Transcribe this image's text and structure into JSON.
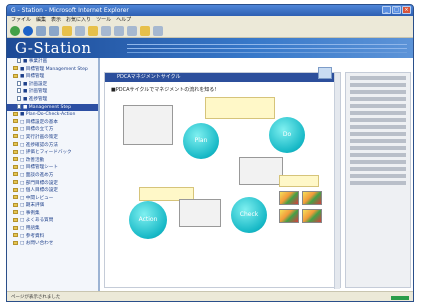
{
  "window": {
    "title": "G - Station - Microsoft Internet Explorer"
  },
  "menu": [
    "ファイル",
    "編集",
    "表示",
    "お気に入り",
    "ツール",
    "ヘルプ"
  ],
  "banner": {
    "logo": "G-Station"
  },
  "sidebar": {
    "items": [
      {
        "label": "■ 事業計画",
        "type": "doc"
      },
      {
        "label": "■ 目標管理 Management Step",
        "type": "fold"
      },
      {
        "label": "■ 目標管理",
        "type": "fold"
      },
      {
        "label": "■ 計画設定",
        "type": "doc"
      },
      {
        "label": "■ 計画管理",
        "type": "doc"
      },
      {
        "label": "■ 進捗管理",
        "type": "doc"
      },
      {
        "label": "■ Management Step",
        "type": "doc",
        "selected": true
      },
      {
        "label": "■ Plan-Do-Check-Action",
        "type": "fold"
      },
      {
        "label": "□ 目標設定の基本",
        "type": "fold"
      },
      {
        "label": "□ 目標の立て方",
        "type": "fold"
      },
      {
        "label": "□ 実行計画の策定",
        "type": "fold"
      },
      {
        "label": "□ 進捗確認の方法",
        "type": "fold"
      },
      {
        "label": "□ 評価とフィードバック",
        "type": "fold"
      },
      {
        "label": "□ 改善活動",
        "type": "fold"
      },
      {
        "label": "□ 目標管理シート",
        "type": "fold"
      },
      {
        "label": "□ 面談の進め方",
        "type": "fold"
      },
      {
        "label": "□ 部門目標の設定",
        "type": "fold"
      },
      {
        "label": "□ 個人目標の設定",
        "type": "fold"
      },
      {
        "label": "□ 中間レビュー",
        "type": "fold"
      },
      {
        "label": "□ 期末評価",
        "type": "fold"
      },
      {
        "label": "□ 事例集",
        "type": "fold"
      },
      {
        "label": "□ よくある質問",
        "type": "fold"
      },
      {
        "label": "□ 用語集",
        "type": "fold"
      },
      {
        "label": "□ 参考資料",
        "type": "fold"
      },
      {
        "label": "□ お問い合わせ",
        "type": "fold"
      }
    ]
  },
  "panel": {
    "header": "PDCAマネジメントサイクル",
    "subtitle": "■PDCAサイクルでマネジメントの流れを知る!",
    "nodes": {
      "plan": "Plan",
      "do": "Do",
      "check": "Check",
      "action": "Action"
    }
  },
  "statusbar": {
    "text": "ページが表示されました"
  }
}
